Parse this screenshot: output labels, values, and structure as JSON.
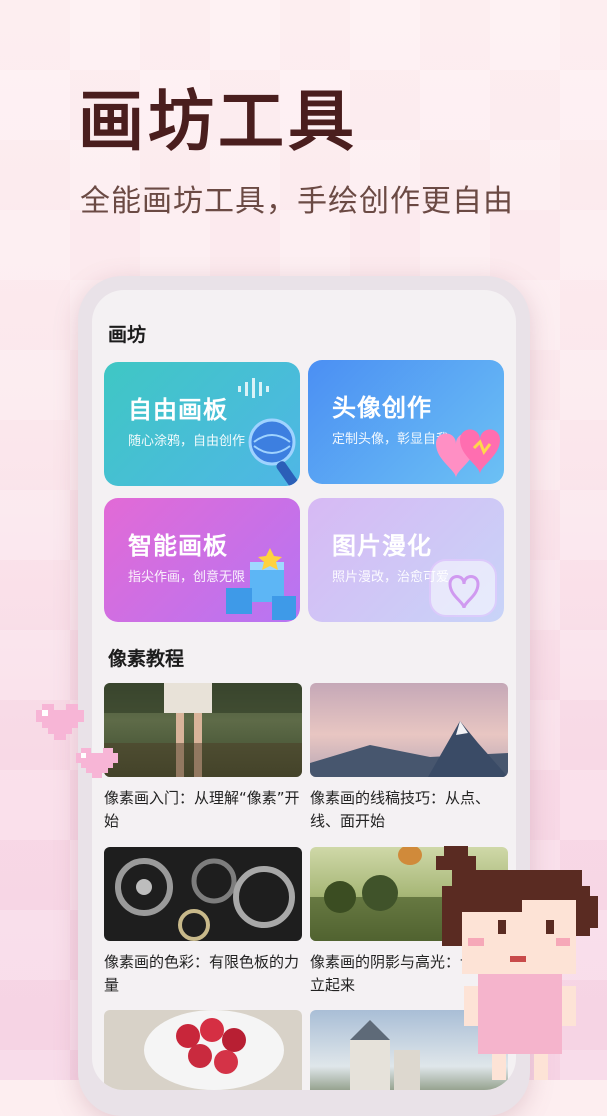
{
  "hero": {
    "title": "画坊工具",
    "subtitle": "全能画坊工具，手绘创作更自由"
  },
  "sections": {
    "studio_title": "画坊",
    "tutorial_title": "像素教程"
  },
  "cards": [
    {
      "title": "自由画板",
      "subtitle": "随心涂鸦，自由创作",
      "icon": "microphone-icon"
    },
    {
      "title": "头像创作",
      "subtitle": "定制头像，彰显自我",
      "icon": "hearts-icon"
    },
    {
      "title": "智能画板",
      "subtitle": "指尖作画，创意无限",
      "icon": "cubes-icon"
    },
    {
      "title": "图片漫化",
      "subtitle": "照片漫改，治愈可爱",
      "icon": "heart-device-icon"
    }
  ],
  "tutorials": [
    {
      "title": "像素画入门：从理解“像素”开始",
      "image": "forest-legs-photo"
    },
    {
      "title": "像素画的线稿技巧：从点、线、面开始",
      "image": "mountain-photo"
    },
    {
      "title": "像素画的色彩：有限色板的力量",
      "image": "gears-photo"
    },
    {
      "title": "像素画的阴影与高光：让物体立起来",
      "image": "balloon-landscape-photo"
    },
    {
      "title": "",
      "image": "raspberries-photo"
    },
    {
      "title": "",
      "image": "castle-photo"
    }
  ],
  "colors": {
    "title": "#4a1e1e",
    "subtitle": "#6b4a44",
    "card_free": "#3fc7c4",
    "card_avatar": "#4b8ff3",
    "card_smart": "#e26ad6",
    "card_comic": "#d7b9f4"
  }
}
